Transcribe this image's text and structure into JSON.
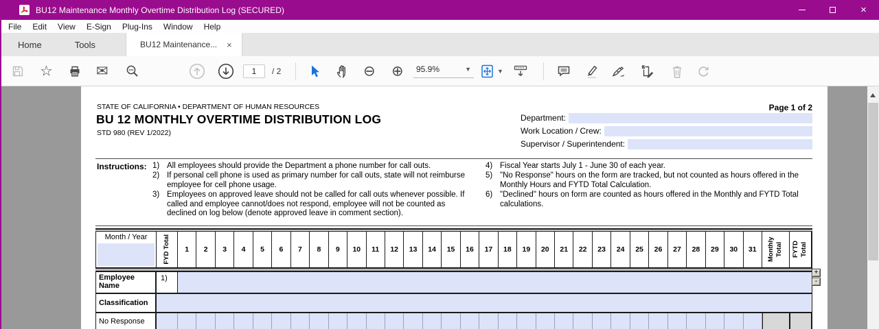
{
  "window": {
    "title": "BU12 Maintenance Monthly Overtime Distribution Log (SECURED)",
    "controls": {
      "close": "×"
    },
    "titlebar_color": "#9a0c8e"
  },
  "menu": {
    "items": [
      "File",
      "Edit",
      "View",
      "E-Sign",
      "Plug-Ins",
      "Window",
      "Help"
    ]
  },
  "tabs": {
    "home": "Home",
    "tools": "Tools",
    "document": "BU12 Maintenance...",
    "close": "×"
  },
  "toolbar": {
    "page_current": "1",
    "page_total": "/ 2",
    "zoom_level": "95.9%",
    "accent_color": "#1b72d9",
    "icons": [
      "save-icon",
      "favorite-star-icon",
      "print-icon",
      "email-icon",
      "search-icon",
      "page-up-icon",
      "page-down-icon",
      "select-tool-icon",
      "hand-tool-icon",
      "zoom-out-icon",
      "zoom-in-icon",
      "zoom-dropdown",
      "page-fit-icon",
      "scroll-mode-icon",
      "comment-icon",
      "highlight-icon",
      "sign-icon",
      "edit-page-icon",
      "delete-icon",
      "redo-icon"
    ]
  },
  "document": {
    "page_indicator": "Page 1 of 2",
    "agency_line": "STATE OF CALIFORNIA • DEPARTMENT OF HUMAN RESOURCES",
    "title": "BU 12 MONTHLY OVERTIME DISTRIBUTION LOG",
    "form_number": "STD 980 (REV 1/2022)",
    "field_color": "#dde3f9",
    "header_fields": [
      {
        "label": "Department:",
        "value": ""
      },
      {
        "label": "Work Location / Crew:",
        "value": ""
      },
      {
        "label": "Supervisor / Superintendent:",
        "value": ""
      }
    ],
    "instructions": {
      "label": "Instructions:",
      "left": [
        {
          "num": "1)",
          "text": "All employees should provide the Department a phone number for call outs."
        },
        {
          "num": "2)",
          "text": "If personal cell phone is used as primary number for call outs, state will not reimburse employee for cell phone usage."
        },
        {
          "num": "3)",
          "text": "Employees on approved leave should not be called for call outs whenever possible. If called and employee cannot/does not respond, employee will not be counted as declined on log below (denote approved leave in comment section)."
        }
      ],
      "right": [
        {
          "num": "4)",
          "text": "Fiscal Year starts July 1 - June 30 of each year."
        },
        {
          "num": "5)",
          "text": "\"No Response\" hours on the form are tracked, but not counted as hours offered in the Monthly Hours and FYTD Total Calculation."
        },
        {
          "num": "6)",
          "text": "\"Declined\" hours on form are counted as hours offered in the Monthly and FYTD Total calculations."
        }
      ]
    },
    "table": {
      "month_year_label": "Month / Year",
      "fyd_total_label": "FYD Total",
      "days": [
        "1",
        "2",
        "3",
        "4",
        "5",
        "6",
        "7",
        "8",
        "9",
        "10",
        "11",
        "12",
        "13",
        "14",
        "15",
        "16",
        "17",
        "18",
        "19",
        "20",
        "21",
        "22",
        "23",
        "24",
        "25",
        "26",
        "27",
        "28",
        "29",
        "30",
        "31"
      ],
      "monthly_total_label": "Monthly Total",
      "fytd_total_label": "FYTD Total",
      "employee_row": {
        "label": "Employee Name",
        "prefix": "1)"
      },
      "classification_row": {
        "label": "Classification"
      },
      "no_response_row": {
        "label": "No Response"
      },
      "row_buttons": {
        "add": "+",
        "remove": "-"
      }
    }
  }
}
